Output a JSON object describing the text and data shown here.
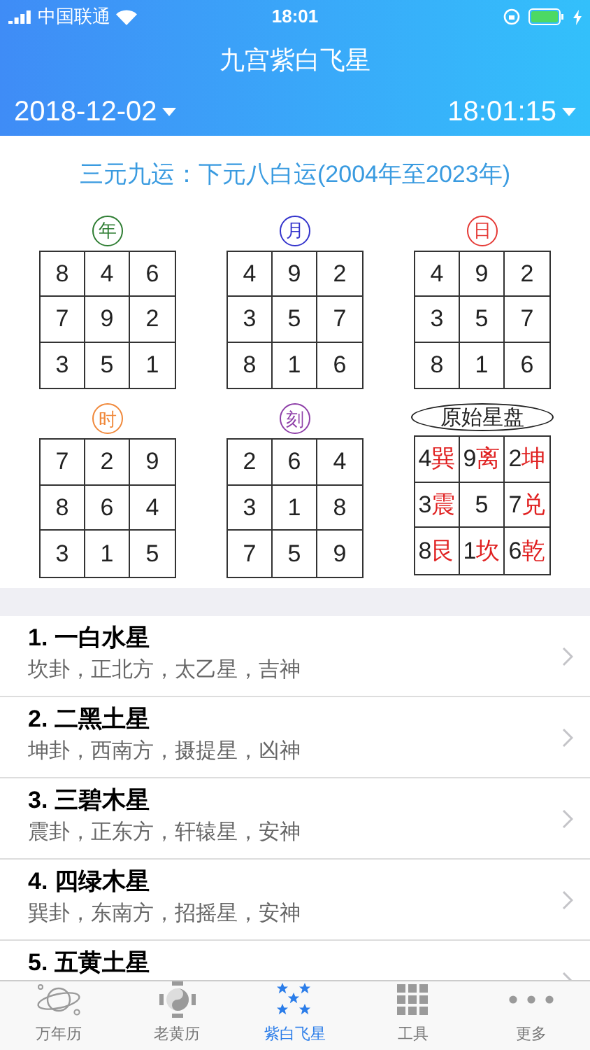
{
  "status_bar": {
    "carrier": "中国联通",
    "time": "18:01"
  },
  "header": {
    "title": "九宫紫白飞星",
    "date": "2018-12-02",
    "time": "18:01:15"
  },
  "era": "三元九运：下元八白运(2004年至2023年)",
  "grids": [
    {
      "label": "年",
      "kind": "circle",
      "color": "#2e7d32",
      "cells": [
        {
          "number": "8"
        },
        {
          "number": "4"
        },
        {
          "number": "6"
        },
        {
          "number": "7"
        },
        {
          "number": "9"
        },
        {
          "number": "2"
        },
        {
          "number": "3"
        },
        {
          "number": "5"
        },
        {
          "number": "1"
        }
      ]
    },
    {
      "label": "月",
      "kind": "circle",
      "color": "#3333cc",
      "cells": [
        {
          "number": "4"
        },
        {
          "number": "9"
        },
        {
          "number": "2"
        },
        {
          "number": "3"
        },
        {
          "number": "5"
        },
        {
          "number": "7"
        },
        {
          "number": "8"
        },
        {
          "number": "1"
        },
        {
          "number": "6"
        }
      ]
    },
    {
      "label": "日",
      "kind": "circle",
      "color": "#e53935",
      "cells": [
        {
          "number": "4"
        },
        {
          "number": "9"
        },
        {
          "number": "2"
        },
        {
          "number": "3"
        },
        {
          "number": "5"
        },
        {
          "number": "7"
        },
        {
          "number": "8"
        },
        {
          "number": "1"
        },
        {
          "number": "6"
        }
      ]
    },
    {
      "label": "时",
      "kind": "circle",
      "color": "#f0883a",
      "cells": [
        {
          "number": "7"
        },
        {
          "number": "2"
        },
        {
          "number": "9"
        },
        {
          "number": "8"
        },
        {
          "number": "6"
        },
        {
          "number": "4"
        },
        {
          "number": "3"
        },
        {
          "number": "1"
        },
        {
          "number": "5"
        }
      ]
    },
    {
      "label": "刻",
      "kind": "circle",
      "color": "#8e3fa8",
      "cells": [
        {
          "number": "2"
        },
        {
          "number": "6"
        },
        {
          "number": "4"
        },
        {
          "number": "3"
        },
        {
          "number": "1"
        },
        {
          "number": "8"
        },
        {
          "number": "7"
        },
        {
          "number": "5"
        },
        {
          "number": "9"
        }
      ]
    },
    {
      "label": "原始星盘",
      "kind": "oval",
      "color": "#222222",
      "cells": [
        {
          "number": "4",
          "trigram": "巽"
        },
        {
          "number": "9",
          "trigram": "离"
        },
        {
          "number": "2",
          "trigram": "坤"
        },
        {
          "number": "3",
          "trigram": "震"
        },
        {
          "number": "5"
        },
        {
          "number": "7",
          "trigram": "兑"
        },
        {
          "number": "8",
          "trigram": "艮"
        },
        {
          "number": "1",
          "trigram": "坎"
        },
        {
          "number": "6",
          "trigram": "乾"
        }
      ]
    }
  ],
  "stars": [
    {
      "title": "1. 一白水星",
      "detail": "坎卦，正北方，太乙星，吉神"
    },
    {
      "title": "2. 二黑土星",
      "detail": "坤卦，西南方，摄提星，凶神"
    },
    {
      "title": "3. 三碧木星",
      "detail": "震卦，正东方，轩辕星，安神"
    },
    {
      "title": "4. 四绿木星",
      "detail": "巽卦，东南方，招摇星，安神"
    },
    {
      "title": "5. 五黄土星"
    }
  ],
  "tabs": [
    {
      "label": "万年历",
      "selected": false
    },
    {
      "label": "老黄历",
      "selected": false
    },
    {
      "label": "紫白飞星",
      "selected": true
    },
    {
      "label": "工具",
      "selected": false
    },
    {
      "label": "更多",
      "selected": false
    }
  ]
}
